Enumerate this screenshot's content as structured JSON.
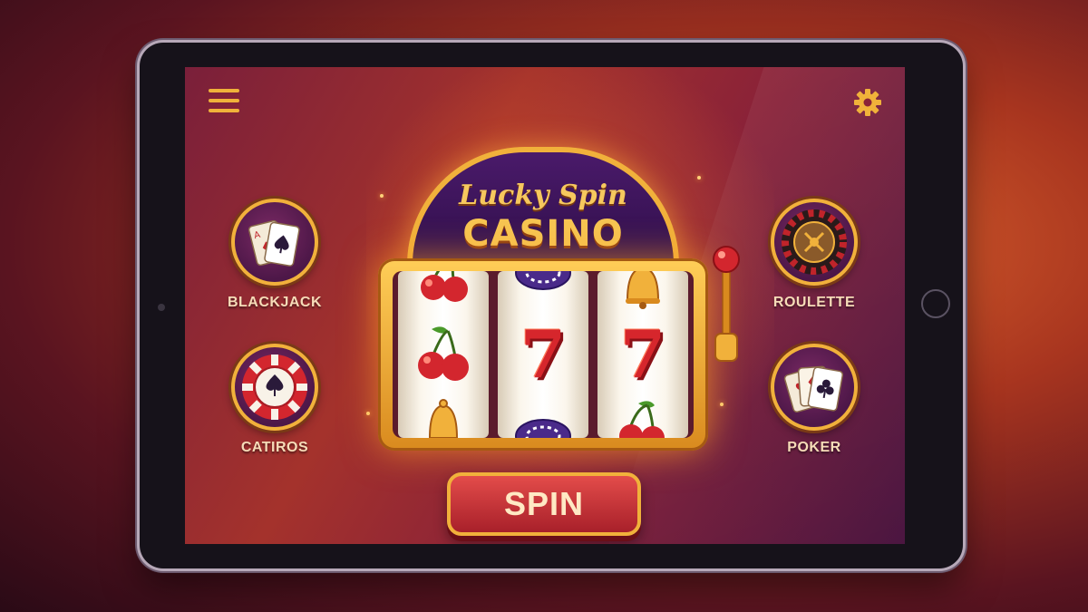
{
  "app": {
    "title_line1": "Lucky Spin",
    "title_line2": "CASINO"
  },
  "header": {
    "menu_icon": "hamburger-menu-icon",
    "settings_icon": "gear-icon"
  },
  "games_left": [
    {
      "label": "BLACKJACK",
      "icon": "playing-cards-icon"
    },
    {
      "label": "CATIROS",
      "icon": "poker-chip-icon"
    }
  ],
  "games_right": [
    {
      "label": "ROULETTE",
      "icon": "roulette-wheel-icon"
    },
    {
      "label": "POKER",
      "icon": "playing-cards-icon"
    }
  ],
  "reels": [
    {
      "symbols": [
        "cherry-icon",
        "cherry-icon",
        "bell-icon"
      ]
    },
    {
      "symbols": [
        "poker-chip-icon",
        "seven",
        "poker-chip-icon"
      ],
      "center_text": "7"
    },
    {
      "symbols": [
        "bell-icon",
        "seven",
        "cherry-icon"
      ],
      "center_text": "7"
    }
  ],
  "spin_button": {
    "label": "SPIN"
  },
  "colors": {
    "gold": "#f1b13b",
    "purple": "#4a1a6a",
    "red": "#d6262c",
    "background": "#a4322c"
  }
}
